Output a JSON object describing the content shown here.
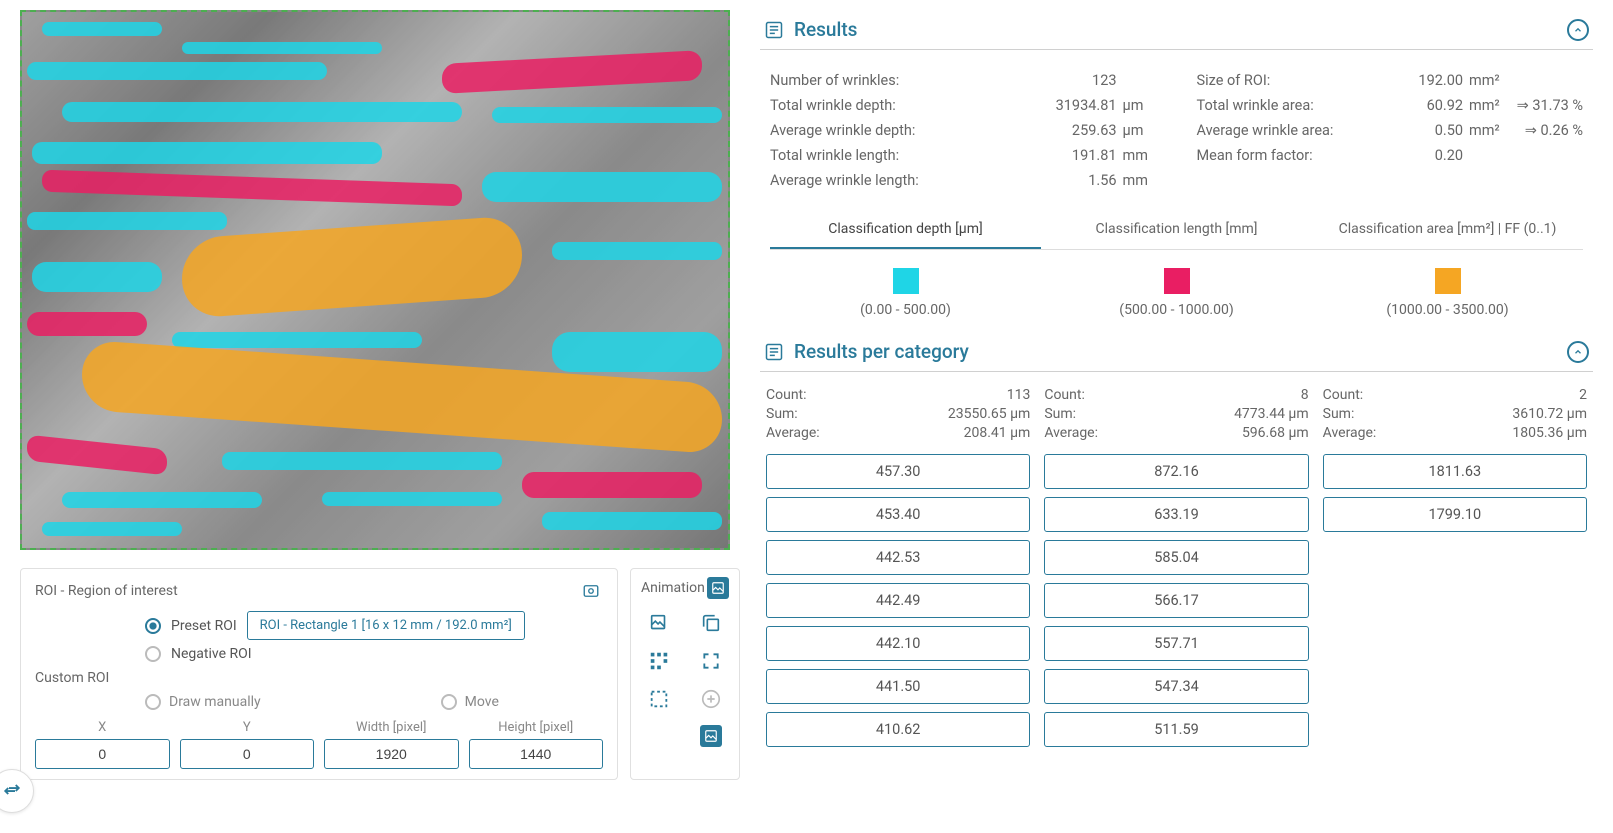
{
  "roi": {
    "title": "ROI - Region of interest",
    "preset_label": "Preset ROI",
    "preset_value": "ROI - Rectangle 1 [16 x 12 mm / 192.0 mm²]",
    "negative_label": "Negative ROI",
    "custom_label": "Custom ROI",
    "draw_label": "Draw manually",
    "move_label": "Move",
    "coords": {
      "x_label": "X",
      "x_value": "0",
      "y_label": "Y",
      "y_value": "0",
      "w_label": "Width [pixel]",
      "w_value": "1920",
      "h_label": "Height [pixel]",
      "h_value": "1440"
    }
  },
  "animation": {
    "title": "Animation"
  },
  "results": {
    "title": "Results",
    "left": [
      {
        "label": "Number of wrinkles:",
        "val": "123",
        "unit": ""
      },
      {
        "label": "Total wrinkle depth:",
        "val": "31934.81",
        "unit": "µm"
      },
      {
        "label": "Average wrinkle depth:",
        "val": "259.63",
        "unit": "µm"
      },
      {
        "label": "Total wrinkle length:",
        "val": "191.81",
        "unit": "mm"
      },
      {
        "label": "Average wrinkle length:",
        "val": "1.56",
        "unit": "mm"
      }
    ],
    "right": [
      {
        "label": "Size of ROI:",
        "val": "192.00",
        "unit": "mm²",
        "extra": ""
      },
      {
        "label": "Total wrinkle area:",
        "val": "60.92",
        "unit": "mm²",
        "extra": "⇒   31.73 %"
      },
      {
        "label": "Average wrinkle area:",
        "val": "0.50",
        "unit": "mm²",
        "extra": "⇒   0.26 %"
      },
      {
        "label": "Mean form factor:",
        "val": "0.20",
        "unit": "",
        "extra": ""
      }
    ],
    "tabs": {
      "depth": "Classification depth [µm]",
      "length": "Classification length [mm]",
      "area": "Classification area [mm²] | FF (0..1)"
    },
    "legend": [
      {
        "color": "#1fd5e6",
        "range": "(0.00 - 500.00)"
      },
      {
        "color": "#e91e63",
        "range": "(500.00 - 1000.00)"
      },
      {
        "color": "#f5a623",
        "range": "(1000.00 - 3500.00)"
      }
    ]
  },
  "rpc": {
    "title": "Results per category",
    "cols": [
      {
        "count": "113",
        "sum": "23550.65 µm",
        "avg": "208.41 µm",
        "cells": [
          "457.30",
          "453.40",
          "442.53",
          "442.49",
          "442.10",
          "441.50",
          "410.62"
        ]
      },
      {
        "count": "8",
        "sum": "4773.44 µm",
        "avg": "596.68 µm",
        "cells": [
          "872.16",
          "633.19",
          "585.04",
          "566.17",
          "557.71",
          "547.34",
          "511.59"
        ]
      },
      {
        "count": "2",
        "sum": "3610.72 µm",
        "avg": "1805.36 µm",
        "cells": [
          "1811.63",
          "1799.10"
        ]
      }
    ],
    "labels": {
      "count": "Count:",
      "sum": "Sum:",
      "avg": "Average:"
    }
  }
}
